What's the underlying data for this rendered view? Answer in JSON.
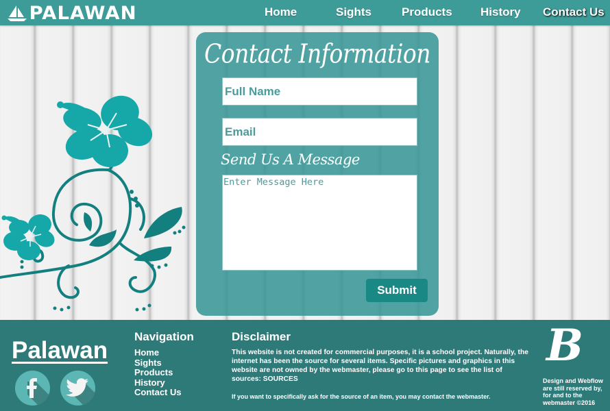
{
  "header": {
    "logo_text": "PALAWAN",
    "logo_icon": "sailboat-icon",
    "nav": [
      {
        "label": "Home",
        "active": false
      },
      {
        "label": "Sights",
        "active": false
      },
      {
        "label": "Products",
        "active": false
      },
      {
        "label": "History",
        "active": false
      },
      {
        "label": "Contact Us",
        "active": true
      }
    ]
  },
  "contact": {
    "title": "Contact Information",
    "full_name_placeholder": "Full Name",
    "email_placeholder": "Email",
    "message_label": "Send Us A Message",
    "message_placeholder": "Enter Message Here",
    "submit_label": "Submit"
  },
  "decoration": {
    "icon": "hibiscus-flower-icon"
  },
  "footer": {
    "brand": "Palawan",
    "social": [
      {
        "name": "facebook",
        "icon": "facebook-icon",
        "glyph": "f"
      },
      {
        "name": "twitter",
        "icon": "twitter-icon"
      }
    ],
    "navigation": {
      "title": "Navigation",
      "links": [
        "Home",
        "Sights",
        "Products",
        "History",
        "Contact Us"
      ]
    },
    "disclaimer": {
      "title": "Disclaimer",
      "text": "This website is not created for commercial purposes, it is a school project. Naturally, the internet has been the source for several items. Specific pictures and graphics in this website are not owned by the webmaster, please go to this page to see the list of sources: SOURCES",
      "note": "If you want to specifically ask for the source of an item, you may contact the webmaster."
    },
    "b_logo": "B",
    "rights": "Design and Webflow are still reserved by, for and to the webmaster ©2016"
  },
  "colors": {
    "header": "#3d9b98",
    "panel": "#3b9897",
    "footer": "#2e7a79",
    "submit": "#1a8986",
    "flower_light": "#16a7a9",
    "flower_dark": "#137f7f"
  }
}
